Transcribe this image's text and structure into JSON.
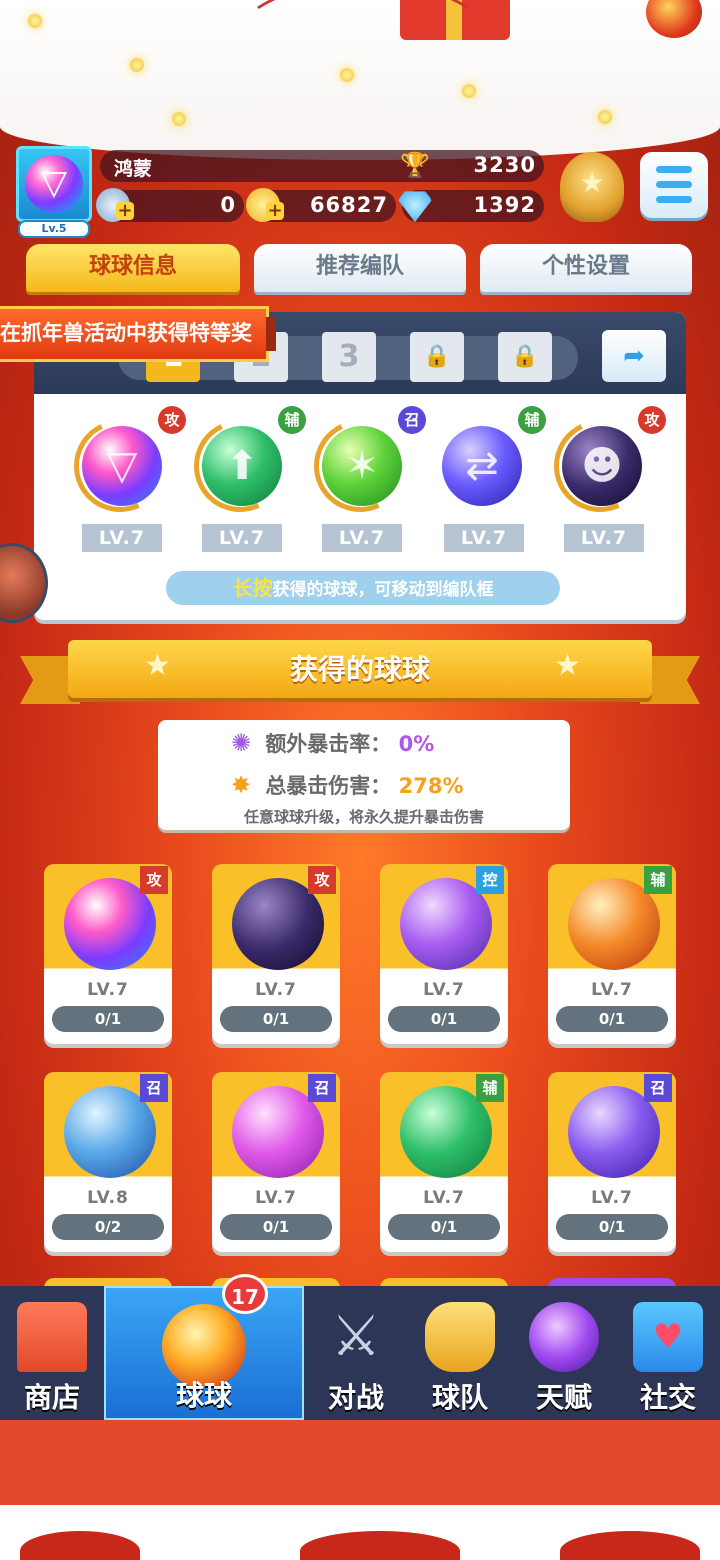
{
  "player": {
    "name": "鸿蒙",
    "level_tag": "Lv.5",
    "trophies": "3230",
    "stars": "0",
    "coins": "66827",
    "diamonds": "1392"
  },
  "tabs": [
    {
      "label": "球球信息",
      "active": true
    },
    {
      "label": "推荐编队",
      "active": false
    },
    {
      "label": "个性设置",
      "active": false
    }
  ],
  "notice": "在抓年兽活动中获得特等奖",
  "team_slots": [
    {
      "label": "1",
      "state": "active"
    },
    {
      "label": "2",
      "state": "normal"
    },
    {
      "label": "3",
      "state": "normal"
    },
    {
      "label": "",
      "state": "locked"
    },
    {
      "label": "",
      "state": "locked"
    }
  ],
  "team_balls": [
    {
      "name": "prism-ball",
      "role": "攻",
      "level": "LV.7"
    },
    {
      "name": "arrow-star-ball",
      "role": "辅",
      "level": "LV.7"
    },
    {
      "name": "green-hex-ball",
      "role": "召",
      "level": "LV.7"
    },
    {
      "name": "swap-ball",
      "role": "辅",
      "level": "LV.7"
    },
    {
      "name": "venom-ball",
      "role": "攻",
      "level": "LV.7"
    }
  ],
  "hint": {
    "highlight": "长按",
    "rest": "获得的球球，可移动到编队框"
  },
  "section_title": "获得的球球",
  "crit": {
    "extra_label": "额外暴击率：",
    "extra_value": "0%",
    "total_label": "总暴击伤害：",
    "total_value": "278%",
    "note": "任意球球升级，将永久提升暴击伤害"
  },
  "owned_balls": [
    {
      "name": "prism-ball",
      "role": "攻",
      "level": "LV.7",
      "count": "0/1"
    },
    {
      "name": "venom-ball",
      "role": "攻",
      "level": "LV.7",
      "count": "0/1"
    },
    {
      "name": "butterfly-ball",
      "role": "控",
      "level": "LV.7",
      "count": "0/1"
    },
    {
      "name": "phoenix-ball",
      "role": "辅",
      "level": "LV.7",
      "count": "0/1"
    },
    {
      "name": "whirlwind-ball",
      "role": "召",
      "level": "LV.8",
      "count": "0/2"
    },
    {
      "name": "mushroom-cloud-ball",
      "role": "召",
      "level": "LV.7",
      "count": "0/1"
    },
    {
      "name": "arrow-star-ball",
      "role": "辅",
      "level": "LV.7",
      "count": "0/1"
    },
    {
      "name": "planet-ball",
      "role": "召",
      "level": "LV.7",
      "count": "0/1"
    }
  ],
  "nav": [
    {
      "label": "商店",
      "icon": "shop-icon",
      "active": false
    },
    {
      "label": "球球",
      "icon": "ball-icon",
      "active": true,
      "badge": "17"
    },
    {
      "label": "对战",
      "icon": "crossed-swords-icon",
      "active": false
    },
    {
      "label": "球队",
      "icon": "whistle-icon",
      "active": false
    },
    {
      "label": "天赋",
      "icon": "planet-icon",
      "active": false
    },
    {
      "label": "社交",
      "icon": "chat-heart-icon",
      "active": false
    }
  ],
  "colors": {
    "attack": "#d63a2a",
    "support": "#3aa040",
    "summon": "#5a4ad6",
    "control": "#2f9fe0",
    "tab_active": "#f5b81c",
    "nav_active": "#1a6fd4"
  }
}
